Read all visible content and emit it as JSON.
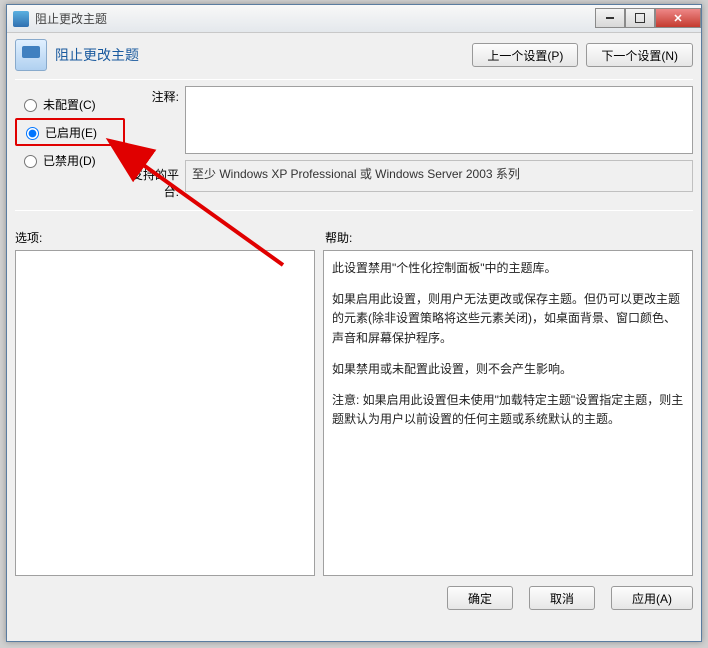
{
  "window": {
    "title": "阻止更改主题"
  },
  "header": {
    "title": "阻止更改主题",
    "prev": "上一个设置(P)",
    "next": "下一个设置(N)"
  },
  "radios": {
    "not_configured": "未配置(C)",
    "enabled": "已启用(E)",
    "disabled": "已禁用(D)",
    "selected": "enabled"
  },
  "comment": {
    "label": "注释:",
    "value": ""
  },
  "platform": {
    "label": "支持的平台:",
    "value": "至少 Windows XP Professional 或 Windows Server 2003 系列"
  },
  "sections": {
    "options": "选项:",
    "help": "帮助:"
  },
  "help": {
    "p1": "此设置禁用\"个性化控制面板\"中的主题库。",
    "p2": "如果启用此设置，则用户无法更改或保存主题。但仍可以更改主题的元素(除非设置策略将这些元素关闭)，如桌面背景、窗口颜色、声音和屏幕保护程序。",
    "p3": "如果禁用或未配置此设置，则不会产生影响。",
    "p4": "注意: 如果启用此设置但未使用\"加载特定主题\"设置指定主题，则主题默认为用户以前设置的任何主题或系统默认的主题。"
  },
  "footer": {
    "ok": "确定",
    "cancel": "取消",
    "apply": "应用(A)"
  }
}
